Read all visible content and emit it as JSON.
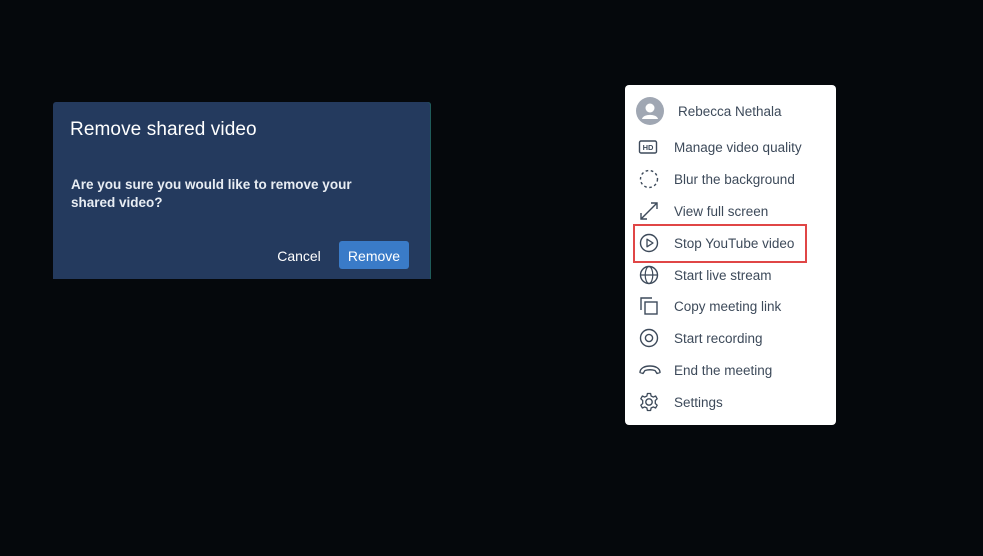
{
  "dialog": {
    "title": "Remove shared video",
    "message": "Are you sure you would like to remove your shared video?",
    "cancel_label": "Cancel",
    "confirm_label": "Remove"
  },
  "menu": {
    "user_name": "Rebecca Nethala",
    "items": [
      {
        "label": "Manage video quality",
        "icon": "hd-icon"
      },
      {
        "label": "Blur the background",
        "icon": "blur-icon"
      },
      {
        "label": "View full screen",
        "icon": "fullscreen-icon"
      },
      {
        "label": "Stop YouTube video",
        "icon": "play-circle-icon"
      },
      {
        "label": "Start live stream",
        "icon": "globe-icon"
      },
      {
        "label": "Copy meeting link",
        "icon": "copy-icon"
      },
      {
        "label": "Start recording",
        "icon": "record-icon"
      },
      {
        "label": "End the meeting",
        "icon": "hangup-icon"
      },
      {
        "label": "Settings",
        "icon": "gear-icon"
      }
    ]
  },
  "colors": {
    "background": "#05080c",
    "dialog_bg": "#243a5e",
    "primary_button": "#3a7bc8",
    "menu_text": "#3d4a5a",
    "highlight": "#e04646"
  }
}
